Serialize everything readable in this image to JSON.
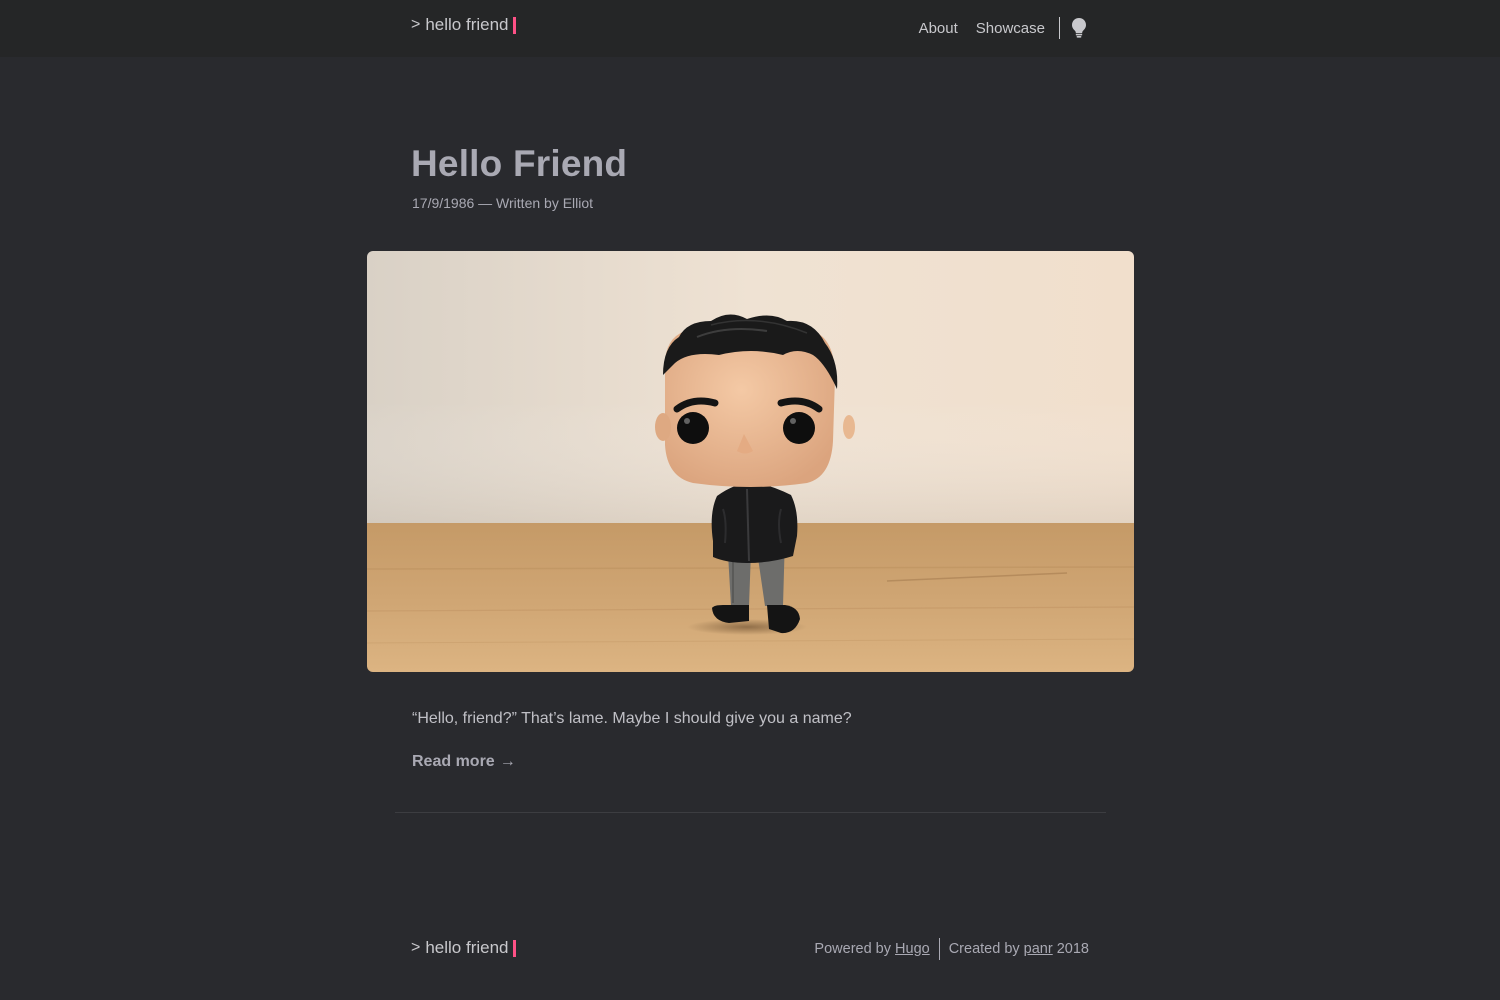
{
  "header": {
    "logo_mark": ">",
    "logo_text": "hello friend",
    "nav": [
      {
        "label": "About"
      },
      {
        "label": "Showcase"
      }
    ],
    "theme_toggle_icon": "lightbulb-icon"
  },
  "post": {
    "title": "Hello Friend",
    "meta": "17/9/1986 — Written by Elliot",
    "excerpt": "“Hello, friend?” That’s lame. Maybe I should give you a name?",
    "read_more": "Read more",
    "read_more_arrow": "→"
  },
  "footer": {
    "logo_mark": ">",
    "logo_text": "hello friend",
    "powered_prefix": "Powered by ",
    "powered_link": "Hugo",
    "created_prefix": "Created by ",
    "created_link": "panr",
    "year": "2018"
  },
  "colors": {
    "background": "#292a2e",
    "header_background": "#252627",
    "accent": "#fe5186",
    "text": "#a9a9b3"
  }
}
